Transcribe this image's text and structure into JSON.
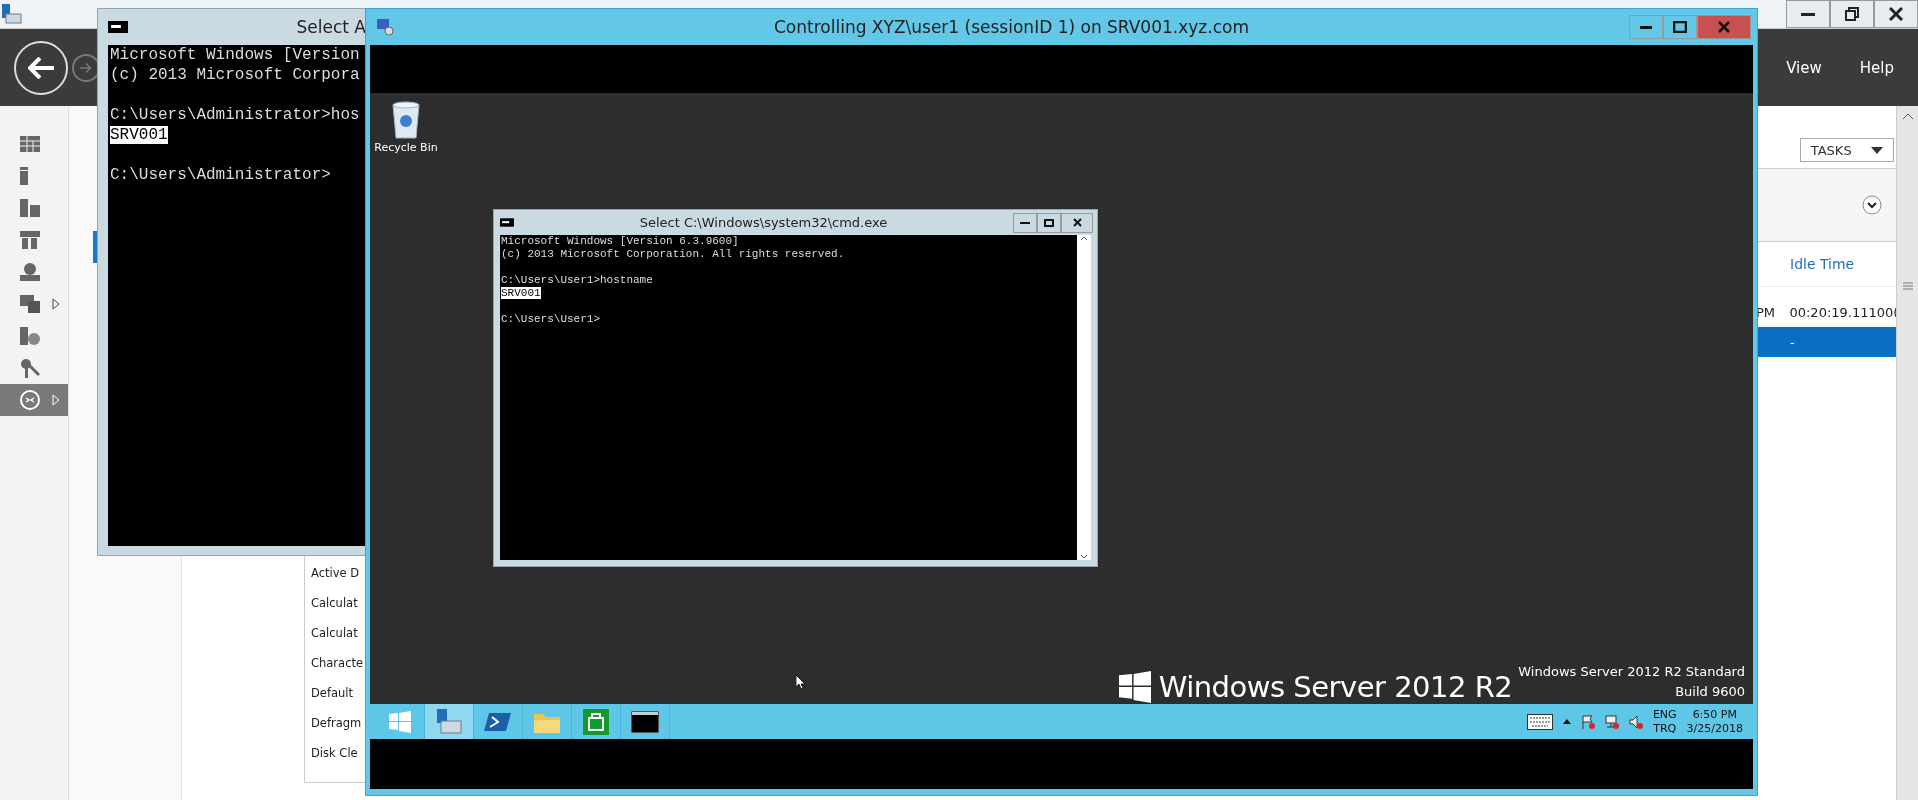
{
  "server_manager": {
    "menu": [
      "View",
      "Help"
    ],
    "sidebar": [
      {
        "kind": "dashboard",
        "selected": false
      },
      {
        "kind": "server",
        "selected": false
      },
      {
        "kind": "servers",
        "selected": false
      },
      {
        "kind": "cluster",
        "selected": false
      },
      {
        "kind": "web",
        "selected": false
      },
      {
        "kind": "files",
        "selected": false,
        "expandable": true
      },
      {
        "kind": "iis",
        "selected": false
      },
      {
        "kind": "keys",
        "selected": false
      },
      {
        "kind": "remote",
        "selected": true,
        "expandable": true
      }
    ],
    "tasks_menu": [
      "Active D",
      "Calculat",
      "Calculat",
      "Characte",
      "Default",
      "Defragm",
      "Disk Cle"
    ],
    "tasks_button": "TASKS",
    "column": "Idle Time",
    "rows": [
      {
        "cells": [
          "PM",
          "00:20:19.11100("
        ],
        "selected": false
      },
      {
        "cells": [
          "",
          "-"
        ],
        "selected": true
      }
    ]
  },
  "background_console": {
    "title": "Select A",
    "blocks": [
      [
        {
          "text": "Microsoft Windows [Version",
          "selected": false
        },
        {
          "text": "(c) 2013 Microsoft Corpora",
          "selected": false
        }
      ],
      [
        {
          "text": "C:\\Users\\Administrator>hos",
          "selected": false
        },
        {
          "text": "SRV001",
          "selected": true
        }
      ],
      [
        {
          "text": "C:\\Users\\Administrator>",
          "selected": false
        }
      ]
    ]
  },
  "remote_window": {
    "title": "Controlling XYZ\\user1 (sessionID 1) on SRV001.xyz.com",
    "desktop_icons": [
      {
        "label": "Recycle Bin"
      }
    ],
    "console": {
      "title": "Select C:\\Windows\\system32\\cmd.exe",
      "blocks": [
        [
          {
            "text": "Microsoft Windows [Version 6.3.9600]",
            "selected": false
          },
          {
            "text": "(c) 2013 Microsoft Corporation. All rights reserved.",
            "selected": false
          }
        ],
        [
          {
            "text": "C:\\Users\\User1>hostname",
            "selected": false
          },
          {
            "text": "SRV001",
            "selected": true
          }
        ],
        [
          {
            "text": "C:\\Users\\User1>",
            "selected": false
          }
        ]
      ]
    },
    "branding": {
      "logo_text": "Windows Server 2012 R2",
      "edition": "Windows Server 2012 R2 Standard",
      "build": "Build 9600"
    },
    "taskbar": [
      {
        "kind": "start",
        "selected": false
      },
      {
        "kind": "server-manager",
        "selected": true
      },
      {
        "kind": "powershell",
        "selected": false
      },
      {
        "kind": "explorer",
        "selected": false
      },
      {
        "kind": "store",
        "selected": false
      },
      {
        "kind": "console",
        "selected": false
      }
    ],
    "tray": {
      "language": "ENG",
      "layout": "TRQ",
      "time": "6:50 PM",
      "date": "3/25/2018"
    }
  }
}
